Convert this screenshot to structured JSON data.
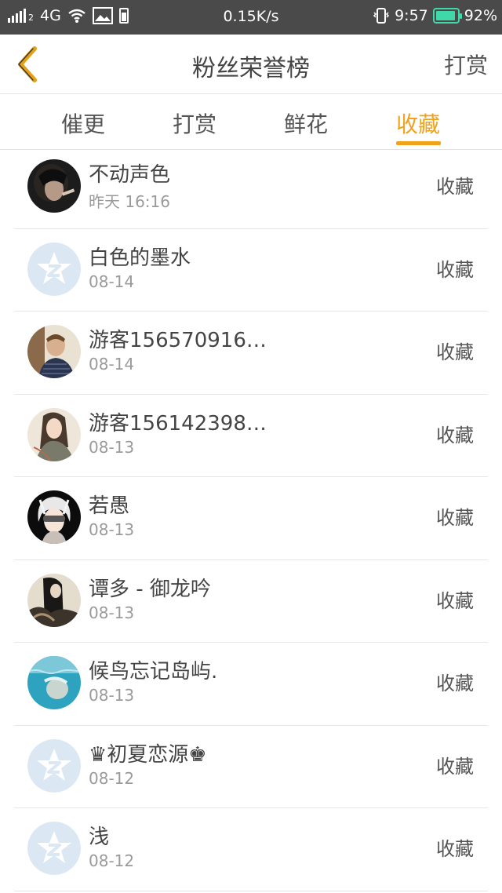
{
  "status_bar": {
    "network": "4G",
    "speed": "0.15K/s",
    "time": "9:57",
    "battery": "92%",
    "battery_level": 0.92,
    "signal_sub": "2"
  },
  "header": {
    "title": "粉丝荣誉榜",
    "action": "打赏"
  },
  "tabs": [
    {
      "label": "催更",
      "active": false
    },
    {
      "label": "打赏",
      "active": false
    },
    {
      "label": "鲜花",
      "active": false
    },
    {
      "label": "收藏",
      "active": true
    }
  ],
  "fans": [
    {
      "name": "不动声色",
      "date": "昨天 16:16",
      "action": "收藏",
      "avatar": "photo-dark-hair"
    },
    {
      "name": "白色的墨水",
      "date": "08-14",
      "action": "收藏",
      "avatar": "default-qzone"
    },
    {
      "name": "游客156570916…",
      "date": "08-14",
      "action": "收藏",
      "avatar": "photo-man-striped"
    },
    {
      "name": "游客156142398…",
      "date": "08-13",
      "action": "收藏",
      "avatar": "illustration-girl"
    },
    {
      "name": "若愚",
      "date": "08-13",
      "action": "收藏",
      "avatar": "anime-white-hair"
    },
    {
      "name": "谭多 - 御龙吟",
      "date": "08-13",
      "action": "收藏",
      "avatar": "illustration-dark"
    },
    {
      "name": "候鸟忘记岛屿.",
      "date": "08-13",
      "action": "收藏",
      "avatar": "photo-underwater"
    },
    {
      "name": "♛初夏恋源♚",
      "date": "08-12",
      "action": "收藏",
      "avatar": "default-qzone"
    },
    {
      "name": "浅",
      "date": "08-12",
      "action": "收藏",
      "avatar": "default-qzone"
    }
  ],
  "colors": {
    "accent": "#f0a21b",
    "status_bar": "#4a4a4a",
    "battery": "#3fd8a8",
    "default_avatar": "#dbe7f3"
  }
}
